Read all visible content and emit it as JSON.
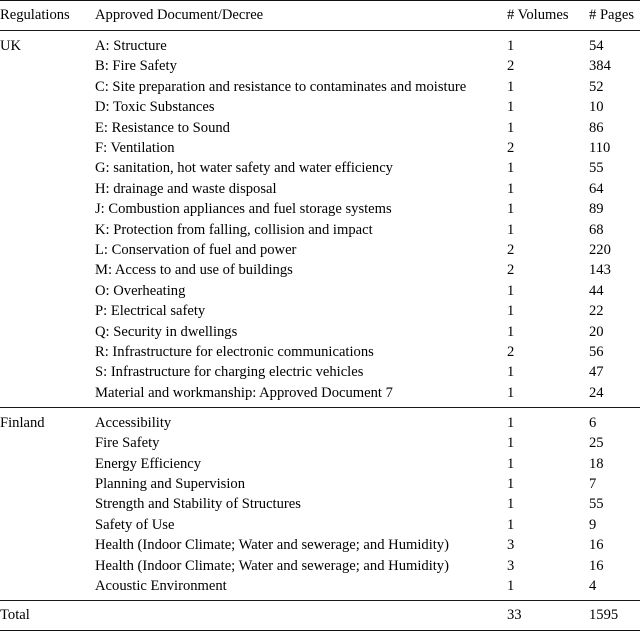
{
  "table": {
    "columns": [
      {
        "key": "regulations",
        "label": "Regulations"
      },
      {
        "key": "document",
        "label": "Approved Document/Decree"
      },
      {
        "key": "volumes",
        "label": "# Volumes"
      },
      {
        "key": "pages",
        "label": "# Pages"
      }
    ],
    "groups": [
      {
        "name": "UK",
        "rows": [
          {
            "document": "A: Structure",
            "volumes": "1",
            "pages": "54"
          },
          {
            "document": "B: Fire Safety",
            "volumes": "2",
            "pages": "384"
          },
          {
            "document": "C: Site preparation and resistance to contaminates and moisture",
            "volumes": "1",
            "pages": "52"
          },
          {
            "document": "D: Toxic Substances",
            "volumes": "1",
            "pages": "10"
          },
          {
            "document": "E: Resistance to Sound",
            "volumes": "1",
            "pages": "86"
          },
          {
            "document": "F: Ventilation",
            "volumes": "2",
            "pages": "110"
          },
          {
            "document": "G: sanitation, hot water safety and water efficiency",
            "volumes": "1",
            "pages": "55"
          },
          {
            "document": "H: drainage and waste disposal",
            "volumes": "1",
            "pages": "64"
          },
          {
            "document": "J: Combustion appliances and fuel storage systems",
            "volumes": "1",
            "pages": "89"
          },
          {
            "document": "K: Protection from falling, collision and impact",
            "volumes": "1",
            "pages": "68"
          },
          {
            "document": "L: Conservation of fuel and power",
            "volumes": "2",
            "pages": "220"
          },
          {
            "document": "M: Access to and use of buildings",
            "volumes": "2",
            "pages": "143"
          },
          {
            "document": "O: Overheating",
            "volumes": "1",
            "pages": "44"
          },
          {
            "document": "P: Electrical safety",
            "volumes": "1",
            "pages": "22"
          },
          {
            "document": "Q: Security in dwellings",
            "volumes": "1",
            "pages": "20"
          },
          {
            "document": "R: Infrastructure for electronic communications",
            "volumes": "2",
            "pages": "56"
          },
          {
            "document": "S: Infrastructure for charging electric vehicles",
            "volumes": "1",
            "pages": "47"
          },
          {
            "document": "Material and workmanship: Approved Document 7",
            "volumes": "1",
            "pages": "24"
          }
        ]
      },
      {
        "name": "Finland",
        "rows": [
          {
            "document": "Accessibility",
            "volumes": "1",
            "pages": "6"
          },
          {
            "document": "Fire Safety",
            "volumes": "1",
            "pages": "25"
          },
          {
            "document": "Energy Efficiency",
            "volumes": "1",
            "pages": "18"
          },
          {
            "document": "Planning and Supervision",
            "volumes": "1",
            "pages": "7"
          },
          {
            "document": "Strength and Stability of Structures",
            "volumes": "1",
            "pages": "55"
          },
          {
            "document": "Safety of Use",
            "volumes": "1",
            "pages": "9"
          },
          {
            "document": "Health (Indoor Climate; Water and sewerage; and Humidity)",
            "volumes": "3",
            "pages": "16"
          },
          {
            "document": "Health (Indoor Climate; Water and sewerage; and Humidity)",
            "volumes": "3",
            "pages": "16"
          },
          {
            "document": "Acoustic Environment",
            "volumes": "1",
            "pages": "4"
          }
        ]
      }
    ],
    "total": {
      "label": "Total",
      "document": "",
      "volumes": "33",
      "pages": "1595"
    }
  },
  "style": {
    "rule_color": "#111111",
    "text_color": "#000000",
    "background": "#ffffff"
  }
}
